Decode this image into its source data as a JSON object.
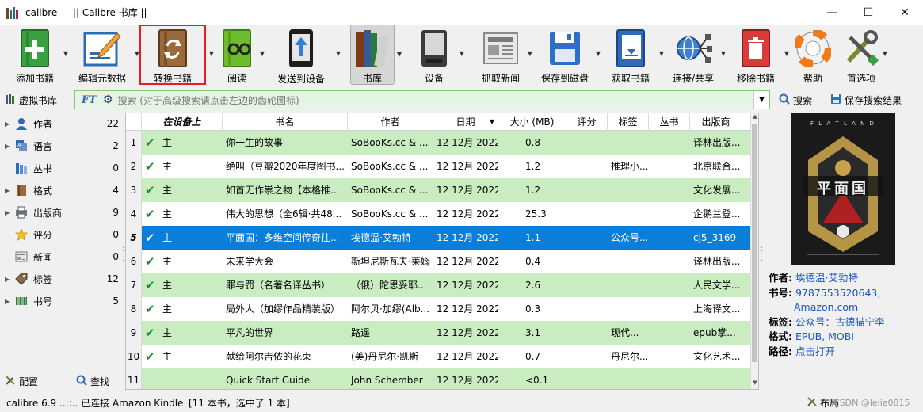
{
  "window": {
    "title": "calibre — || Calibre 书库 ||",
    "minimize": "—",
    "maximize": "☐",
    "close": "✕"
  },
  "toolbar": {
    "add": "添加书籍",
    "edit_meta": "编辑元数据",
    "convert": "转换书籍",
    "read": "阅读",
    "send_device": "发送到设备",
    "library": "书库",
    "device": "设备",
    "fetch_news": "抓取新闻",
    "save_disk": "保存到磁盘",
    "get_books": "获取书籍",
    "connect_share": "连接/共享",
    "remove": "移除书籍",
    "help": "帮助",
    "prefs": "首选项"
  },
  "search": {
    "virtual_lib": "虚拟书库",
    "placeholder": "搜索 (对于高级搜索请点击左边的齿轮图标)",
    "search_btn": "搜索",
    "save_btn": "保存搜索结果"
  },
  "tagbrowser": {
    "items": [
      {
        "name": "作者",
        "count": "22"
      },
      {
        "name": "语言",
        "count": "2"
      },
      {
        "name": "丛书",
        "count": "0"
      },
      {
        "name": "格式",
        "count": "4"
      },
      {
        "name": "出版商",
        "count": "9"
      },
      {
        "name": "评分",
        "count": "0"
      },
      {
        "name": "新闻",
        "count": "0"
      },
      {
        "name": "标签",
        "count": "12"
      },
      {
        "name": "书号",
        "count": "5"
      }
    ],
    "configure": "配置",
    "find": "查找"
  },
  "table": {
    "headers": {
      "ondevice": "在设备上",
      "title": "书名",
      "author": "作者",
      "date": "日期",
      "size": "大小 (MB)",
      "rating": "评分",
      "tags": "标签",
      "series": "丛书",
      "publisher": "出版商"
    },
    "rows": [
      {
        "num": "1",
        "dev": "主",
        "title": "你一生的故事",
        "author": "SoBooKs.cc & ...",
        "date": "12 12月 2022",
        "size": "0.8",
        "tags": "",
        "pub": "译林出版..."
      },
      {
        "num": "2",
        "dev": "主",
        "title": "绝叫（豆瓣2020年度图书...",
        "author": "SoBooKs.cc & ...",
        "date": "12 12月 2022",
        "size": "1.2",
        "tags": "推理小...",
        "pub": "北京联合..."
      },
      {
        "num": "3",
        "dev": "主",
        "title": "如首无作祟之物【本格推...",
        "author": "SoBooKs.cc & ...",
        "date": "12 12月 2022",
        "size": "1.2",
        "tags": "",
        "pub": "文化发展..."
      },
      {
        "num": "4",
        "dev": "主",
        "title": "伟大的思想（全6辑·共48...",
        "author": "SoBooKs.cc & ...",
        "date": "12 12月 2022",
        "size": "25.3",
        "tags": "",
        "pub": "企鹅兰登..."
      },
      {
        "num": "5",
        "dev": "主",
        "title": "平面国：多维空间传奇往...",
        "author": "埃德温·艾勃特",
        "date": "12 12月 2022",
        "size": "1.1",
        "tags": "公众号...",
        "pub": "cj5_3169"
      },
      {
        "num": "6",
        "dev": "主",
        "title": "未来学大会",
        "author": "斯坦尼斯瓦夫·莱姆",
        "date": "12 12月 2022",
        "size": "0.4",
        "tags": "",
        "pub": "译林出版..."
      },
      {
        "num": "7",
        "dev": "主",
        "title": "罪与罚（名著名译丛书）",
        "author": "（俄）陀思妥耶...",
        "date": "12 12月 2022",
        "size": "2.6",
        "tags": "",
        "pub": "人民文学..."
      },
      {
        "num": "8",
        "dev": "主",
        "title": "局外人（加缪作品精装版）",
        "author": "阿尔贝·加缪(Alb...",
        "date": "12 12月 2022",
        "size": "0.3",
        "tags": "",
        "pub": "上海译文..."
      },
      {
        "num": "9",
        "dev": "主",
        "title": "平凡的世界",
        "author": "路遥",
        "date": "12 12月 2022",
        "size": "3.1",
        "tags": "现代...",
        "pub": "epub掌..."
      },
      {
        "num": "10",
        "dev": "主",
        "title": "献给阿尔吉侬的花束",
        "author": "(美)丹尼尔·凯斯",
        "date": "12 12月 2022",
        "size": "0.7",
        "tags": "丹尼尔...",
        "pub": "文化艺术..."
      },
      {
        "num": "11",
        "dev": "",
        "title": "Quick Start Guide",
        "author": "John Schember",
        "date": "12 12月 2022",
        "size": "<0.1",
        "tags": "",
        "pub": ""
      }
    ]
  },
  "cover": {
    "top_text": "F L A T L A N D",
    "title_cn": "平面国"
  },
  "details": {
    "author_label": "作者:",
    "author": "埃德温·艾勃特",
    "isbn_label": "书号:",
    "isbn": "9787553520643,",
    "isbn_src": "Amazon.com",
    "tags_label": "标签:",
    "tags": "公众号：古德猫宁李",
    "formats_label": "格式:",
    "formats": "EPUB, MOBI",
    "path_label": "路径:",
    "path": "点击打开"
  },
  "status": {
    "left": "calibre 6.9 ..::.. 已连接 Amazon Kindle",
    "count": "[11 本书，选中了 1 本]",
    "layout": "布局",
    "watermark": "CSDN @lelie0815"
  }
}
